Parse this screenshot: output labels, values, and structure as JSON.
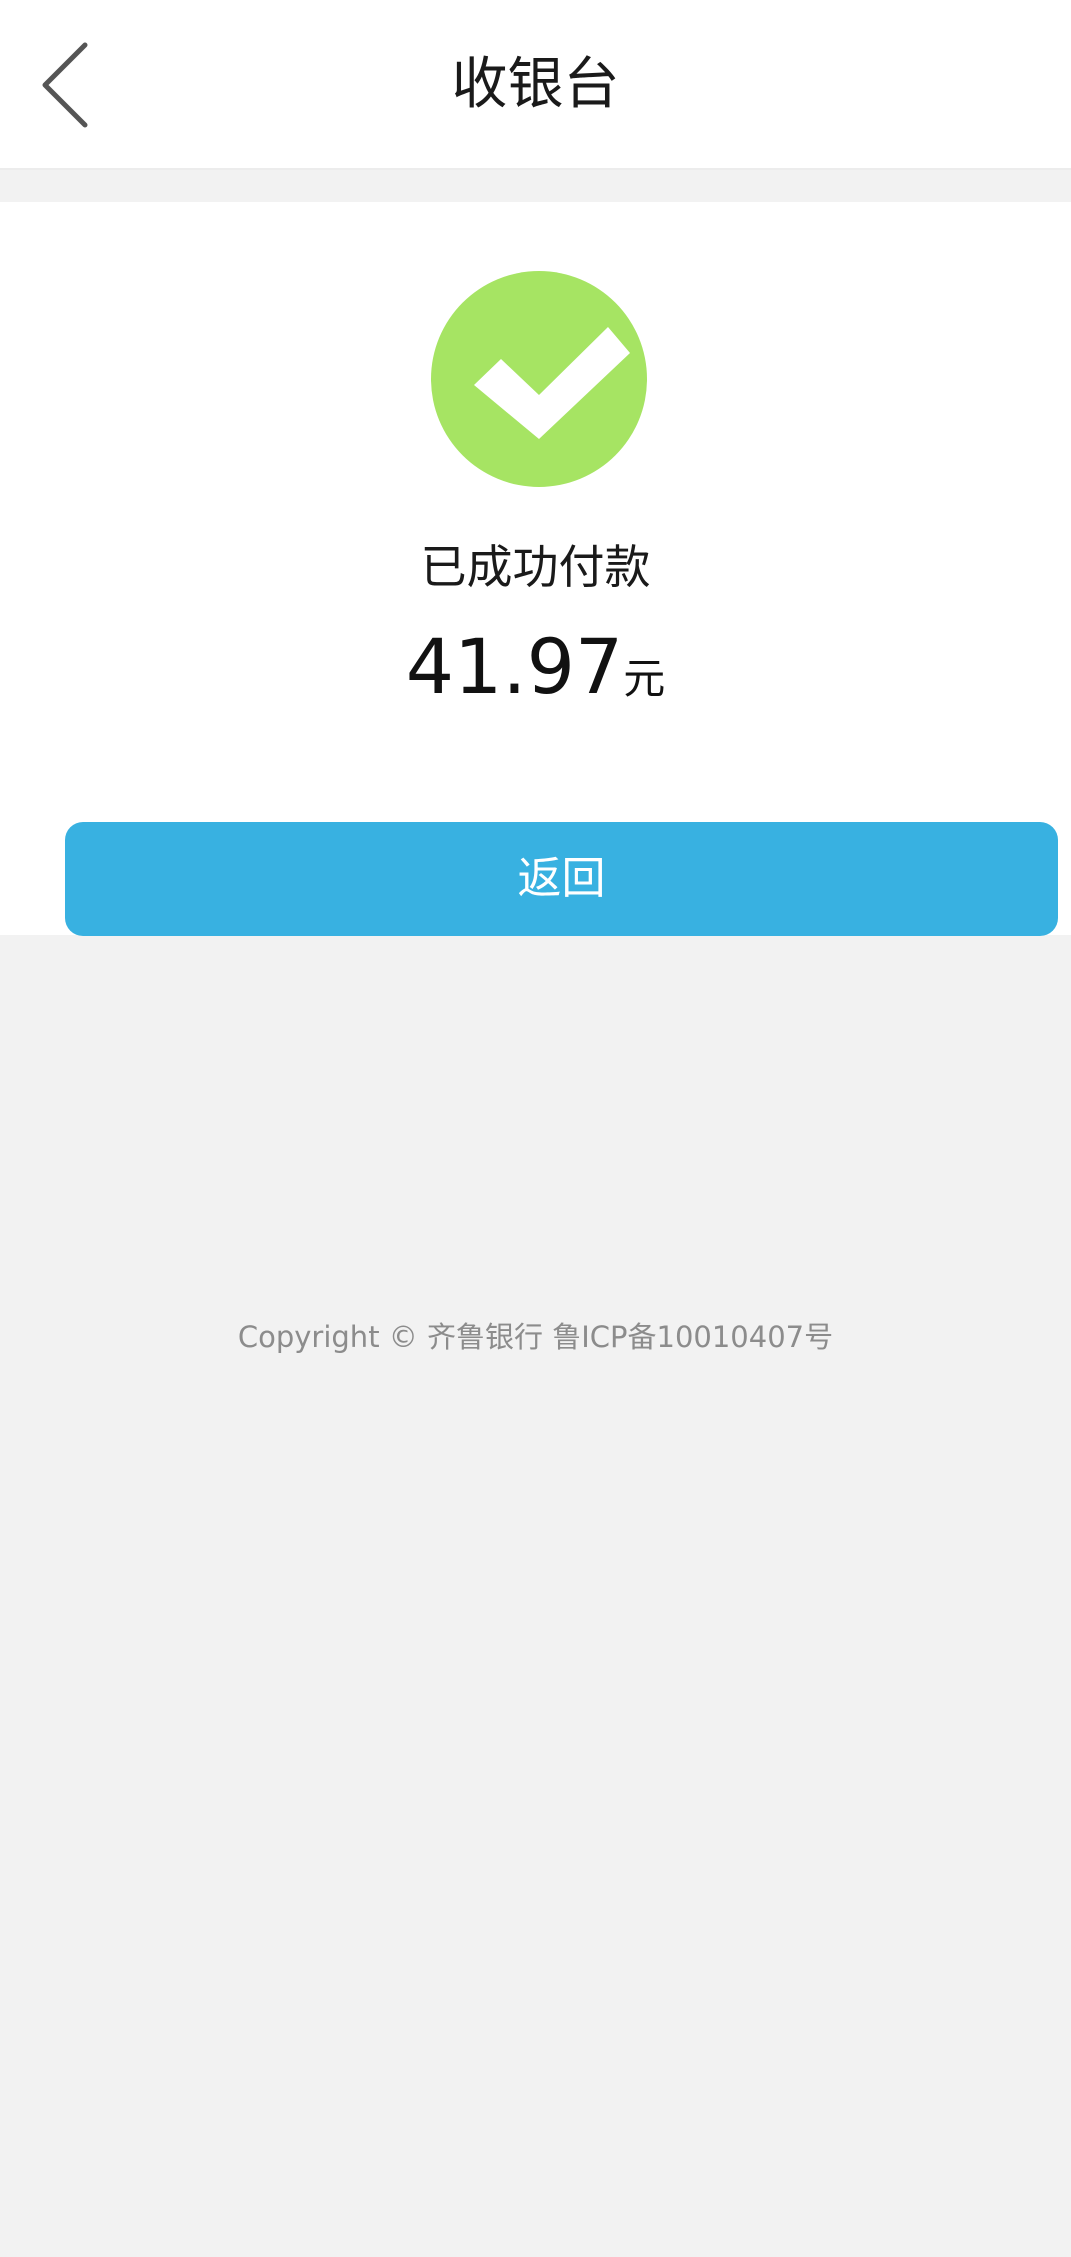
{
  "header": {
    "title": "收银台",
    "back_icon": "chevron-left-icon"
  },
  "result": {
    "icon": "success-check-icon",
    "icon_color": "#a6e463",
    "status_text": "已成功付款",
    "amount": "41.97",
    "unit": "元"
  },
  "actions": {
    "return_label": "返回",
    "return_color": "#38b1e1"
  },
  "footer": {
    "copyright": "Copyright © 齐鲁银行 鲁ICP备10010407号"
  },
  "colors": {
    "background": "#f2f2f2",
    "surface": "#ffffff",
    "muted_text": "#8c8c8c"
  }
}
